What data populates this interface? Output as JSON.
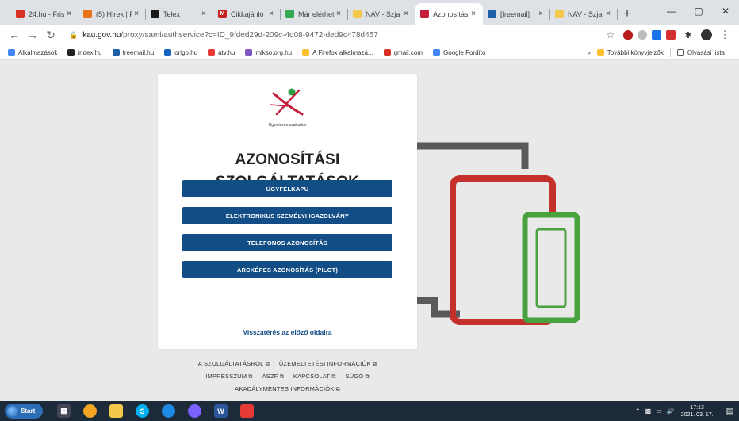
{
  "tabs": [
    {
      "title": "24.hu - Fris",
      "color": "#d93025",
      "glyph": ""
    },
    {
      "title": "(5) Hírek | F",
      "color": "#e8711a",
      "glyph": ""
    },
    {
      "title": "Telex",
      "color": "#1a1a1a",
      "glyph": ""
    },
    {
      "title": "Cikkajánló",
      "color": "#c5221f",
      "glyph": "M"
    },
    {
      "title": "Már elérhető",
      "color": "#34a853",
      "glyph": ""
    },
    {
      "title": "NAV - Szja",
      "color": "#f2c94c",
      "glyph": ""
    },
    {
      "title": "Azonosítás",
      "color": "#c41e3a",
      "glyph": "",
      "active": true
    },
    {
      "title": "[freemail]",
      "color": "#1f5fa8",
      "glyph": ""
    },
    {
      "title": "NAV - Szja",
      "color": "#f2c94c",
      "glyph": ""
    }
  ],
  "address": {
    "host": "kau.gov.hu",
    "path": "/proxy/saml/authservice?c=ID_9fded29d-209c-4d08-9472-ded9c478d457"
  },
  "bookmarks": [
    {
      "label": "Alkalmazások",
      "color": "#4285f4"
    },
    {
      "label": "index.hu",
      "color": "#222"
    },
    {
      "label": "freemail.hu",
      "color": "#1f5fa8"
    },
    {
      "label": "origo.hu",
      "color": "#1565c0"
    },
    {
      "label": "atv.hu",
      "color": "#e53935"
    },
    {
      "label": "mikso.org.hu",
      "color": "#7e57c2"
    },
    {
      "label": "A Firefox alkalmazá...",
      "color": "#fbc02d"
    },
    {
      "label": "gmail.com",
      "color": "#d93025"
    },
    {
      "label": "Google Fordító",
      "color": "#4285f4"
    }
  ],
  "bookmarks_right": {
    "more": "»",
    "other": "További könyvjelzők",
    "reading": "Olvasási lista"
  },
  "card": {
    "logo_caption": "Ügyintézés szabadon",
    "title_line1": "AZONOSÍTÁSI",
    "title_line2": "SZOLGÁLTATÁSOK",
    "buttons": [
      "ÜGYFÉLKAPU",
      "ELEKTRONIKUS SZEMÉLYI IGAZOLVÁNY",
      "TELEFONOS AZONOSÍTÁS",
      "ARCKÉPES AZONOSÍTÁS (PILOT)"
    ],
    "back_link": "Visszatérés az előző oldalra"
  },
  "footer": {
    "row1": [
      "A SZOLGÁLTATÁSRÓL",
      "ÜZEMELTETÉSI INFORMÁCIÓK"
    ],
    "row2": [
      "IMPRESSZUM",
      "ÁSZF",
      "KAPCSOLAT",
      "SÚGÓ"
    ],
    "row3": [
      "AKADÁLYMENTES INFORMÁCIÓK"
    ]
  },
  "taskbar": {
    "start_label": "Start",
    "time": "17:13",
    "date": "2021. 03. 17."
  },
  "colors": {
    "primary_button": "#124d85",
    "device_red": "#c4302b",
    "device_green": "#47a23f",
    "device_gray": "#5a5a5a"
  }
}
